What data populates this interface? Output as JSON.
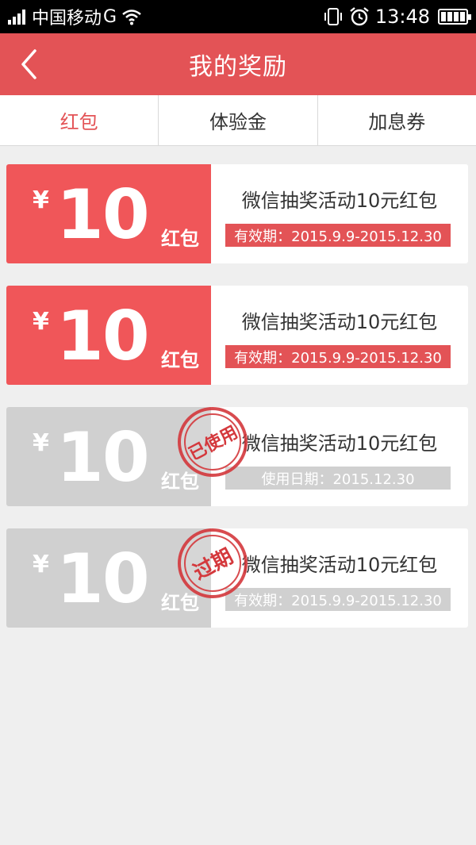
{
  "status": {
    "carrier": "中国移动",
    "network": "G",
    "time": "13:48"
  },
  "header": {
    "title": "我的奖励"
  },
  "tabs": [
    {
      "label": "红包",
      "active": true
    },
    {
      "label": "体验金",
      "active": false
    },
    {
      "label": "加息券",
      "active": false
    }
  ],
  "colors": {
    "accent": "#e35356",
    "card_red": "#f05659",
    "card_gray": "#d0d0d0"
  },
  "cards": [
    {
      "currency": "¥",
      "amount": "10",
      "kind": "红包",
      "title": "微信抽奖活动10元红包",
      "validity": "有效期：2015.9.9-2015.12.30",
      "state": "active"
    },
    {
      "currency": "¥",
      "amount": "10",
      "kind": "红包",
      "title": "微信抽奖活动10元红包",
      "validity": "有效期：2015.9.9-2015.12.30",
      "state": "active"
    },
    {
      "currency": "¥",
      "amount": "10",
      "kind": "红包",
      "title": "微信抽奖活动10元红包",
      "validity": "使用日期：2015.12.30",
      "state": "used",
      "stamp": "已使用"
    },
    {
      "currency": "¥",
      "amount": "10",
      "kind": "红包",
      "title": "微信抽奖活动10元红包",
      "validity": "有效期：2015.9.9-2015.12.30",
      "state": "expired",
      "stamp": "过期"
    }
  ]
}
